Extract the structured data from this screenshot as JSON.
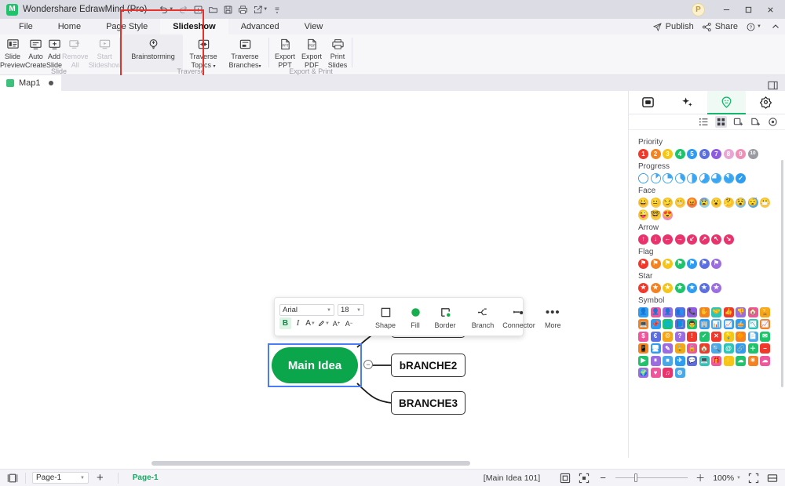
{
  "titlebar": {
    "app_name": "Wondershare EdrawMind (Pro)",
    "logo_glyph": "M",
    "quick_access": [
      {
        "name": "undo-icon",
        "label": "Undo"
      },
      {
        "name": "redo-icon",
        "label": "Redo"
      },
      {
        "name": "new-icon",
        "label": "New"
      },
      {
        "name": "open-folder-icon",
        "label": "Open"
      },
      {
        "name": "save-icon",
        "label": "Save"
      },
      {
        "name": "print-icon",
        "label": "Print"
      },
      {
        "name": "export-icon",
        "label": "Export"
      },
      {
        "name": "customize-icon",
        "label": "Customize Quick Access Toolbar"
      }
    ],
    "avatar_initial": "P",
    "window_buttons": {
      "minimize": "–",
      "maximize": "☐",
      "close": "✕"
    }
  },
  "menubar": {
    "items": [
      {
        "label": "File",
        "active": false
      },
      {
        "label": "Home",
        "active": false
      },
      {
        "label": "Page Style",
        "active": false
      },
      {
        "label": "Slideshow",
        "active": true
      },
      {
        "label": "Advanced",
        "active": false
      },
      {
        "label": "View",
        "active": false
      }
    ],
    "right": [
      {
        "label": "Publish",
        "icon": "send-icon"
      },
      {
        "label": "Share",
        "icon": "share-icon"
      },
      {
        "label": "",
        "icon": "help-icon"
      },
      {
        "label": "",
        "icon": "collapse-ribbon-icon"
      }
    ]
  },
  "ribbon": {
    "groups": [
      {
        "name": "Slide",
        "label": "Slide",
        "buttons": [
          {
            "label": "Slide\nPreview",
            "label_line1": "Slide",
            "label_line2": "Preview",
            "icon": "slide-preview-icon",
            "disabled": false
          },
          {
            "label": "Auto Create",
            "label_line1": "Auto",
            "label_line2": "Create",
            "icon": "auto-create-icon",
            "disabled": false
          },
          {
            "label": "Add Slide",
            "label_line1": "Add",
            "label_line2": "Slide",
            "icon": "add-slide-icon",
            "disabled": false
          },
          {
            "label": "Remove All",
            "label_line1": "Remove",
            "label_line2": "All",
            "icon": "remove-all-icon",
            "disabled": true
          },
          {
            "label": "Start Slideshow",
            "label_line1": "Start",
            "label_line2": "Slideshow",
            "icon": "start-slideshow-icon",
            "disabled": true
          }
        ]
      },
      {
        "name": "Traverse",
        "label": "Traverse",
        "buttons": [
          {
            "label": "Brainstorming",
            "label_line1": "Brainstorming",
            "label_line2": "",
            "icon": "brainstorming-icon",
            "disabled": false,
            "highlight": true
          },
          {
            "label": "Traverse Topics",
            "label_line1": "Traverse",
            "label_line2": "Topics",
            "icon": "traverse-topics-icon",
            "disabled": false,
            "caret": true
          },
          {
            "label": "Traverse Branches",
            "label_line1": "Traverse",
            "label_line2": "Branches",
            "icon": "traverse-branches-icon",
            "disabled": false,
            "caret": true
          }
        ]
      },
      {
        "name": "Export & Print",
        "label": "Export & Print",
        "buttons": [
          {
            "label": "Export PPT",
            "label_line1": "Export",
            "label_line2": "PPT",
            "icon": "export-ppt-icon",
            "disabled": false
          },
          {
            "label": "Export PDF",
            "label_line1": "Export",
            "label_line2": "PDF",
            "icon": "export-pdf-icon",
            "disabled": false
          },
          {
            "label": "Print Slides",
            "label_line1": "Print",
            "label_line2": "Slides",
            "icon": "print-slides-icon",
            "disabled": false
          }
        ]
      }
    ],
    "highlight_color": "#e8312a"
  },
  "doctab": {
    "name": "Map1",
    "modified_dot": true,
    "right_icon": "toggle-panel-icon"
  },
  "canvas": {
    "format_toolbar": {
      "font_family": "Arial",
      "font_size": "18",
      "bold": "B",
      "italic": "I",
      "font_color": "A",
      "highlight": "✐",
      "increase_size": "A⁺",
      "decrease_size": "A⁻",
      "bold_active": true,
      "cells": [
        {
          "label": "Shape",
          "icon": "shape-icon"
        },
        {
          "label": "Fill",
          "icon": "fill-icon"
        },
        {
          "label": "Border",
          "icon": "border-icon"
        },
        {
          "label": "Branch",
          "icon": "branch-icon"
        },
        {
          "label": "Connector",
          "icon": "connector-icon"
        },
        {
          "label": "More",
          "icon": "more-icon"
        }
      ]
    },
    "nodes": {
      "main": {
        "text": "Main Idea",
        "fill": "#0ba54c",
        "selected": true,
        "text_color": "#ffffff"
      },
      "branches": [
        {
          "text": "",
          "hidden_partial": true
        },
        {
          "text": "bRANCHE2"
        },
        {
          "text": "BRANCHE3"
        }
      ]
    },
    "collapse_toggle": "−"
  },
  "right_panel": {
    "tabs": [
      {
        "name": "format-tab",
        "icon": "format-panel-icon",
        "active": false
      },
      {
        "name": "ai-tab",
        "icon": "sparkle-icon",
        "active": false
      },
      {
        "name": "icon-tab",
        "icon": "smiley-icon",
        "active": true
      },
      {
        "name": "clipart-tab",
        "icon": "badge-icon",
        "active": false
      }
    ],
    "subtools": [
      {
        "name": "list-view-icon",
        "selected": false
      },
      {
        "name": "grid-view-icon",
        "selected": true
      },
      {
        "name": "insert-image-icon",
        "selected": false
      },
      {
        "name": "insert-clipart-icon",
        "selected": false
      },
      {
        "name": "target-icon",
        "selected": false
      }
    ],
    "sections": [
      {
        "title": "Priority",
        "shape": "circle",
        "items": [
          {
            "label": "1",
            "color": "#f0392b"
          },
          {
            "label": "2",
            "color": "#f58220"
          },
          {
            "label": "3",
            "color": "#f5c518"
          },
          {
            "label": "4",
            "color": "#1ec36b"
          },
          {
            "label": "5",
            "color": "#2e9cf0"
          },
          {
            "label": "6",
            "color": "#5b6fe0"
          },
          {
            "label": "7",
            "color": "#8e5ce0"
          },
          {
            "label": "8",
            "color": "#e8a6d4"
          },
          {
            "label": "9",
            "color": "#f090b8"
          },
          {
            "label": "10",
            "color": "#9a9aa2"
          }
        ]
      },
      {
        "title": "Progress",
        "shape": "circle",
        "items": [
          {
            "label": "",
            "color": "#2e9cf0",
            "fraction": 0
          },
          {
            "label": "",
            "color": "#3aa5f0",
            "fraction": 0.125
          },
          {
            "label": "",
            "color": "#3aa5f0",
            "fraction": 0.25
          },
          {
            "label": "",
            "color": "#3aa5f0",
            "fraction": 0.375
          },
          {
            "label": "",
            "color": "#3aa5f0",
            "fraction": 0.5
          },
          {
            "label": "",
            "color": "#3aa5f0",
            "fraction": 0.625
          },
          {
            "label": "",
            "color": "#3aa5f0",
            "fraction": 0.75
          },
          {
            "label": "",
            "color": "#3aa5f0",
            "fraction": 0.875
          },
          {
            "label": "✓",
            "color": "#2e9cf0",
            "fraction": 1
          }
        ]
      },
      {
        "title": "Face",
        "shape": "circle",
        "items": [
          {
            "label": "😀",
            "color": "#f7c948"
          },
          {
            "label": "😐",
            "color": "#f7c948"
          },
          {
            "label": "😏",
            "color": "#f7c948"
          },
          {
            "label": "😬",
            "color": "#f7c948"
          },
          {
            "label": "😡",
            "color": "#ef8354"
          },
          {
            "label": "😰",
            "color": "#8fd3f4"
          },
          {
            "label": "😮",
            "color": "#f7c948"
          },
          {
            "label": "🤔",
            "color": "#f7c948"
          },
          {
            "label": "😵",
            "color": "#78c0e8"
          },
          {
            "label": "😴",
            "color": "#4aa8e8"
          },
          {
            "label": "😷",
            "color": "#f7c948"
          },
          {
            "label": "😜",
            "color": "#f7c948"
          },
          {
            "label": "🤓",
            "color": "#f7c948"
          },
          {
            "label": "😍",
            "color": "#f28fb0"
          }
        ]
      },
      {
        "title": "Arrow",
        "shape": "circle",
        "items": [
          {
            "label": "↑",
            "color": "#e8336d"
          },
          {
            "label": "↓",
            "color": "#e8336d"
          },
          {
            "label": "←",
            "color": "#e8336d"
          },
          {
            "label": "→",
            "color": "#e8336d"
          },
          {
            "label": "↙",
            "color": "#e8336d"
          },
          {
            "label": "↗",
            "color": "#e8336d"
          },
          {
            "label": "↖",
            "color": "#e8336d"
          },
          {
            "label": "↘",
            "color": "#e8336d"
          }
        ]
      },
      {
        "title": "Flag",
        "shape": "circle",
        "items": [
          {
            "label": "⚑",
            "color": "#f0392b"
          },
          {
            "label": "⚑",
            "color": "#f58220"
          },
          {
            "label": "⚑",
            "color": "#f5c518"
          },
          {
            "label": "⚑",
            "color": "#1ec36b"
          },
          {
            "label": "⚑",
            "color": "#2e9cf0"
          },
          {
            "label": "⚑",
            "color": "#5b6fe0"
          },
          {
            "label": "⚑",
            "color": "#9b6de0"
          }
        ]
      },
      {
        "title": "Star",
        "shape": "circle",
        "items": [
          {
            "label": "★",
            "color": "#f0392b"
          },
          {
            "label": "★",
            "color": "#f58220"
          },
          {
            "label": "★",
            "color": "#f5c518"
          },
          {
            "label": "★",
            "color": "#1ec36b"
          },
          {
            "label": "★",
            "color": "#2e9cf0"
          },
          {
            "label": "★",
            "color": "#5b6fe0"
          },
          {
            "label": "★",
            "color": "#9b6de0"
          }
        ]
      },
      {
        "title": "Symbol",
        "shape": "square",
        "items": [
          {
            "label": "👤",
            "color": "#2e9cf0"
          },
          {
            "label": "👤",
            "color": "#f0569b"
          },
          {
            "label": "👤",
            "color": "#9b6de0"
          },
          {
            "label": "👥",
            "color": "#5b6fe0"
          },
          {
            "label": "📞",
            "color": "#8e5ce0"
          },
          {
            "label": "✋",
            "color": "#f58220"
          },
          {
            "label": "🤝",
            "color": "#2ec4b6"
          },
          {
            "label": "👍",
            "color": "#f0392b"
          },
          {
            "label": "👎",
            "color": "#9b6de0"
          },
          {
            "label": "🏠",
            "color": "#f0569b"
          },
          {
            "label": "🏆",
            "color": "#f5a518"
          },
          {
            "label": "💻",
            "color": "#f58220"
          },
          {
            "label": "📌",
            "color": "#2e9cf0"
          },
          {
            "label": "🌐",
            "color": "#1ec36b"
          },
          {
            "label": "📘",
            "color": "#5b6fe0"
          },
          {
            "label": "👨",
            "color": "#1ec36b"
          },
          {
            "label": "🏢",
            "color": "#2e9cf0"
          },
          {
            "label": "📊",
            "color": "#4aa8e8"
          },
          {
            "label": "📈",
            "color": "#2e9cf0"
          },
          {
            "label": "🥧",
            "color": "#2e9cf0"
          },
          {
            "label": "📉",
            "color": "#2ec4b6"
          },
          {
            "label": "📈",
            "color": "#f58220"
          },
          {
            "label": "$",
            "color": "#f0569b"
          },
          {
            "label": "€",
            "color": "#5b6fe0"
          },
          {
            "label": "©",
            "color": "#f5a518"
          },
          {
            "label": "?",
            "color": "#9b6de0"
          },
          {
            "label": "!",
            "color": "#f0392b"
          },
          {
            "label": "✓",
            "color": "#1ec36b"
          },
          {
            "label": "✕",
            "color": "#f0392b"
          },
          {
            "label": "💡",
            "color": "#f5c518"
          },
          {
            "label": "🔶",
            "color": "#f58220"
          },
          {
            "label": "📄",
            "color": "#4aa8e8"
          },
          {
            "label": "✉",
            "color": "#1ec36b"
          },
          {
            "label": "📱",
            "color": "#f58220"
          },
          {
            "label": "🖥",
            "color": "#2e9cf0"
          },
          {
            "label": "✎",
            "color": "#9b6de0"
          },
          {
            "label": "🔒",
            "color": "#f5a518"
          },
          {
            "label": "🔓",
            "color": "#f0569b"
          },
          {
            "label": "🏠",
            "color": "#f0392b"
          },
          {
            "label": "🔍",
            "color": "#4aa8e8"
          },
          {
            "label": "@",
            "color": "#2ec4b6"
          },
          {
            "label": "🔗",
            "color": "#2e9cf0"
          },
          {
            "label": "＋",
            "color": "#1ec36b"
          },
          {
            "label": "−",
            "color": "#f0392b"
          },
          {
            "label": "▶",
            "color": "#1ec36b"
          },
          {
            "label": "⏸",
            "color": "#9b6de0"
          },
          {
            "label": "⏹",
            "color": "#4aa8e8"
          },
          {
            "label": "✈",
            "color": "#2e9cf0"
          },
          {
            "label": "💬",
            "color": "#5b6fe0"
          },
          {
            "label": "💻",
            "color": "#2ec4b6"
          },
          {
            "label": "🎁",
            "color": "#f0569b"
          },
          {
            "label": "⚡",
            "color": "#f5c518"
          },
          {
            "label": "☁",
            "color": "#1ec36b"
          },
          {
            "label": "☀",
            "color": "#f58220"
          },
          {
            "label": "☁",
            "color": "#f0569b"
          },
          {
            "label": "🌍",
            "color": "#9b6de0"
          },
          {
            "label": "♥",
            "color": "#f0569b"
          },
          {
            "label": "♫",
            "color": "#e8336d"
          },
          {
            "label": "⚙",
            "color": "#4aa8e8"
          }
        ]
      }
    ]
  },
  "statusbar": {
    "view_icon": "page-view-icon",
    "page_select": "Page-1",
    "add_page": "+",
    "page_chip": "Page-1",
    "selection_info": "[Main Idea 101]",
    "fit_icon": "fit-page-icon",
    "focus_icon": "focus-icon",
    "zoom_out": "−",
    "zoom_in": "＋",
    "zoom_value": "100%",
    "fullscreen_icon": "fullscreen-icon",
    "split_icon": "split-view-icon"
  }
}
